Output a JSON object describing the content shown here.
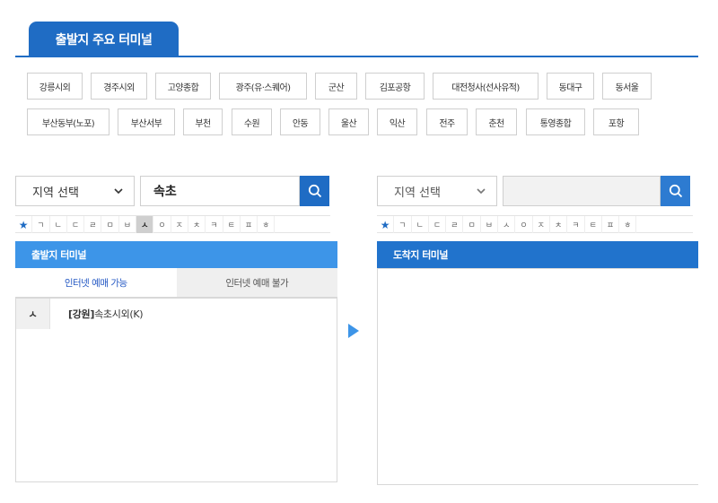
{
  "major_terminals": {
    "tab_label": "출발지 주요 터미널",
    "row1": [
      "강릉시외",
      "경주시외",
      "고양종합",
      "광주(유·스퀘어)",
      "군산",
      "김포공항",
      "대전청사(선사유적)",
      "동대구",
      "동서울"
    ],
    "row2": [
      "부산동부(노포)",
      "부산서부",
      "부천",
      "수원",
      "안동",
      "울산",
      "익산",
      "전주",
      "춘천",
      "통영종합",
      "포항"
    ]
  },
  "departure": {
    "region_select": "지역 선택",
    "search_value": "속초",
    "header": "출발지 터미널",
    "tabs": [
      "인터넷 예매 가능",
      "인터넷 예매 불가"
    ],
    "results": [
      {
        "consonant": "ㅅ",
        "region": "[강원]",
        "name": "속초시외(K)"
      }
    ]
  },
  "arrival": {
    "region_select": "지역 선택",
    "search_value": "",
    "header": "도착지 터미널"
  },
  "consonants": [
    "ㄱ",
    "ㄴ",
    "ㄷ",
    "ㄹ",
    "ㅁ",
    "ㅂ",
    "ㅅ",
    "ㅇ",
    "ㅈ",
    "ㅊ",
    "ㅋ",
    "ㅌ",
    "ㅍ",
    "ㅎ"
  ],
  "favorite_symbol": "★",
  "active_consonant_departure": "ㅅ",
  "icons": {
    "search": "search-icon",
    "chevron": "chevron-down-icon",
    "arrow": "arrow-right-icon"
  },
  "colors": {
    "primary": "#1f6cc4",
    "departure_header": "#3d95e8",
    "arrival_header": "#2173cc",
    "active_tab_text": "#2559c4"
  }
}
